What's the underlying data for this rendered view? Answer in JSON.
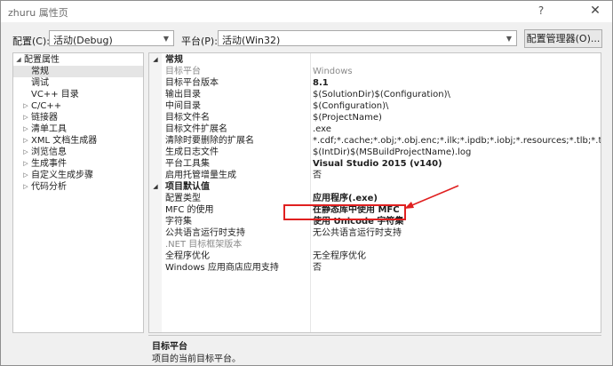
{
  "window": {
    "title": "zhuru 属性页",
    "help_glyph": "?",
    "close_glyph": "✕"
  },
  "toolbar": {
    "config_label": "配置(C):",
    "config_value": "活动(Debug)",
    "platform_label": "平台(P):",
    "platform_value": "活动(Win32)",
    "manager_button": "配置管理器(O)..."
  },
  "tree": {
    "items": [
      {
        "label": "配置属性",
        "expander": "◢",
        "level": 0
      },
      {
        "label": "常规",
        "expander": "",
        "level": 1,
        "selected": true
      },
      {
        "label": "调试",
        "expander": "",
        "level": 1
      },
      {
        "label": "VC++ 目录",
        "expander": "",
        "level": 1
      },
      {
        "label": "C/C++",
        "expander": "▷",
        "level": 1
      },
      {
        "label": "链接器",
        "expander": "▷",
        "level": 1
      },
      {
        "label": "清单工具",
        "expander": "▷",
        "level": 1
      },
      {
        "label": "XML 文档生成器",
        "expander": "▷",
        "level": 1
      },
      {
        "label": "浏览信息",
        "expander": "▷",
        "level": 1
      },
      {
        "label": "生成事件",
        "expander": "▷",
        "level": 1
      },
      {
        "label": "自定义生成步骤",
        "expander": "▷",
        "level": 1
      },
      {
        "label": "代码分析",
        "expander": "▷",
        "level": 1
      }
    ]
  },
  "grid": {
    "sections": [
      {
        "title": "常规",
        "expander": "◢",
        "rows": [
          {
            "name": "目标平台",
            "value": "Windows",
            "dim": true
          },
          {
            "name": "目标平台版本",
            "value": "8.1",
            "bold": true
          },
          {
            "name": "输出目录",
            "value": "$(SolutionDir)$(Configuration)\\"
          },
          {
            "name": "中间目录",
            "value": "$(Configuration)\\"
          },
          {
            "name": "目标文件名",
            "value": "$(ProjectName)"
          },
          {
            "name": "目标文件扩展名",
            "value": ".exe"
          },
          {
            "name": "清除时要删除的扩展名",
            "value": "*.cdf;*.cache;*.obj;*.obj.enc;*.ilk;*.ipdb;*.iobj;*.resources;*.tlb;*.tli;*.tlh;*.tmp"
          },
          {
            "name": "生成日志文件",
            "value": "$(IntDir)$(MSBuildProjectName).log"
          },
          {
            "name": "平台工具集",
            "value": "Visual Studio 2015 (v140)",
            "bold": true
          },
          {
            "name": "启用托管增量生成",
            "value": "否"
          }
        ]
      },
      {
        "title": "项目默认值",
        "expander": "◢",
        "rows": [
          {
            "name": "配置类型",
            "value": "应用程序(.exe)",
            "bold": true
          },
          {
            "name": "MFC 的使用",
            "value": "在静态库中使用 MFC",
            "bold": true
          },
          {
            "name": "字符集",
            "value": "使用 Unicode 字符集",
            "bold": true
          },
          {
            "name": "公共语言运行时支持",
            "value": "无公共语言运行时支持"
          },
          {
            "name": ".NET 目标框架版本",
            "value": "",
            "dim": true
          },
          {
            "name": "全程序优化",
            "value": "无全程序优化"
          },
          {
            "name": "Windows 应用商店应用支持",
            "value": "否"
          }
        ]
      }
    ]
  },
  "description": {
    "title": "目标平台",
    "text": "项目的当前目标平台。"
  },
  "colors": {
    "annotation": "#e02020"
  }
}
